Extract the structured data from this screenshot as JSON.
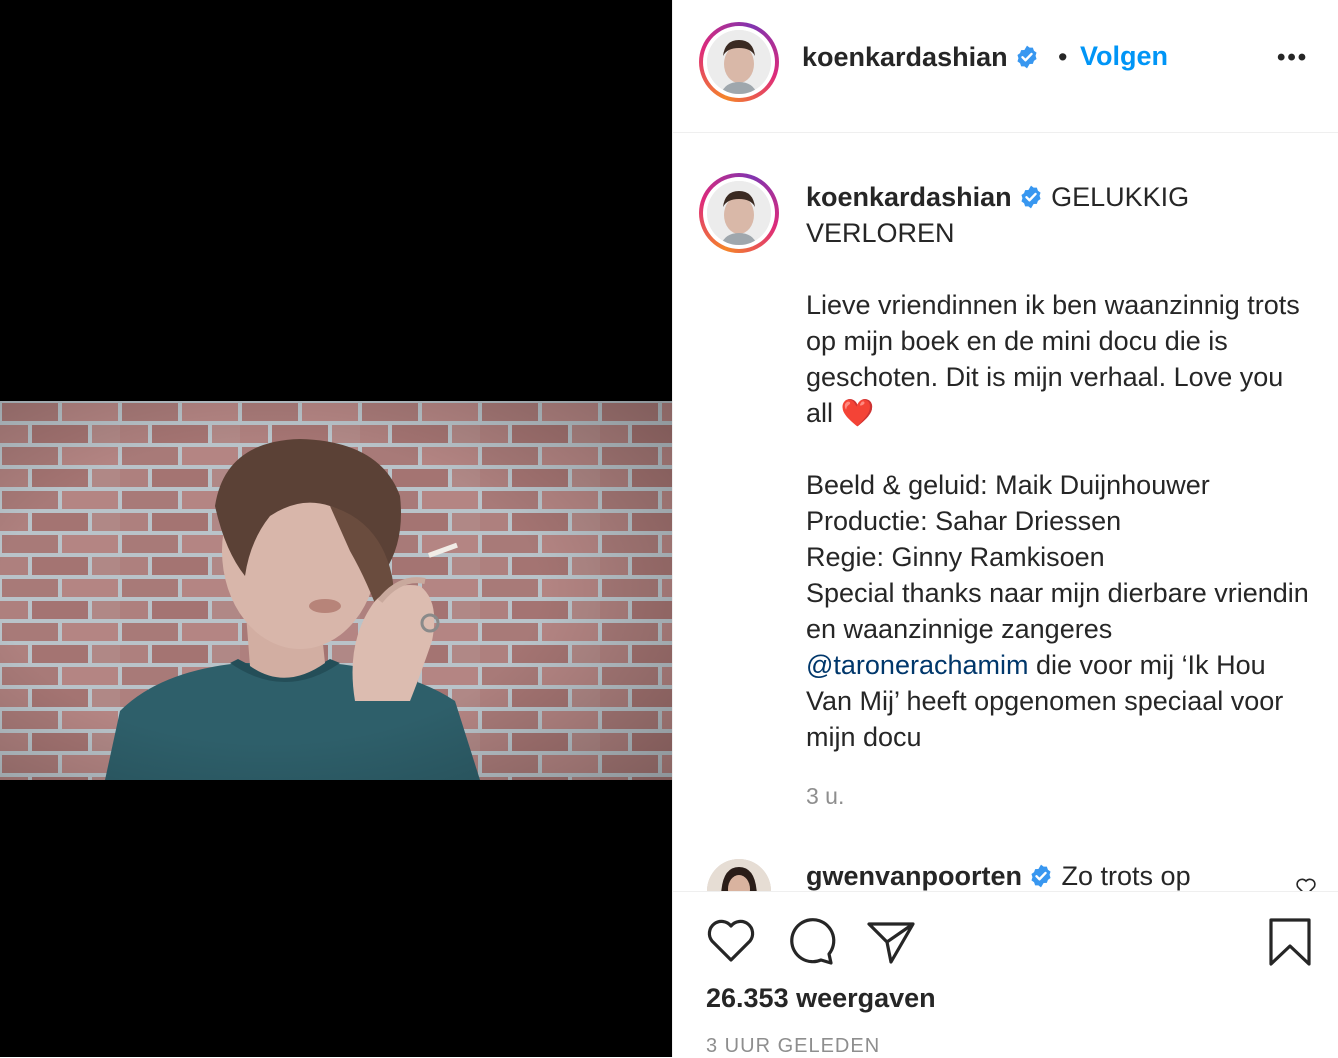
{
  "post": {
    "media_alt": "video still",
    "author": {
      "username": "koenkardashian",
      "verified": true
    },
    "header": {
      "separator": "•",
      "follow_label": "Volgen",
      "more_label": "•••"
    },
    "caption": {
      "username": "koenkardashian",
      "title": "GELUKKIG VERLOREN",
      "paragraph1": "Lieve vriendinnen ik ben waanzinnig trots op mijn boek en de mini docu die is geschoten. Dit is mijn verhaal. Love you all",
      "paragraph1_emoji": "❤️",
      "credits": [
        "Beeld & geluid: Maik Duijnhouwer",
        "Productie: Sahar Driessen",
        "Regie: Ginny Ramkisoen",
        "Special thanks naar mijn dierbare vriendin en waanzinnige zangeres"
      ],
      "mention": "@taronerachamim",
      "after_mention": "die voor mij ‘Ik Hou Van Mij’ heeft opgenomen speciaal voor mijn docu",
      "time": "3 u."
    },
    "comment": {
      "username": "gwenvanpoorten",
      "verified": true,
      "text": "Zo trots op"
    },
    "stats": {
      "views": "26.353 weergaven",
      "posted_ago": "3 UUR GELEDEN"
    },
    "colors": {
      "accent": "#0095f6",
      "mention": "#00376b",
      "muted": "#8e8e8e",
      "verified": "#3897f0"
    },
    "icons": [
      "heart-icon",
      "comment-icon",
      "share-icon",
      "bookmark-icon",
      "verified-badge-icon",
      "more-icon"
    ]
  }
}
